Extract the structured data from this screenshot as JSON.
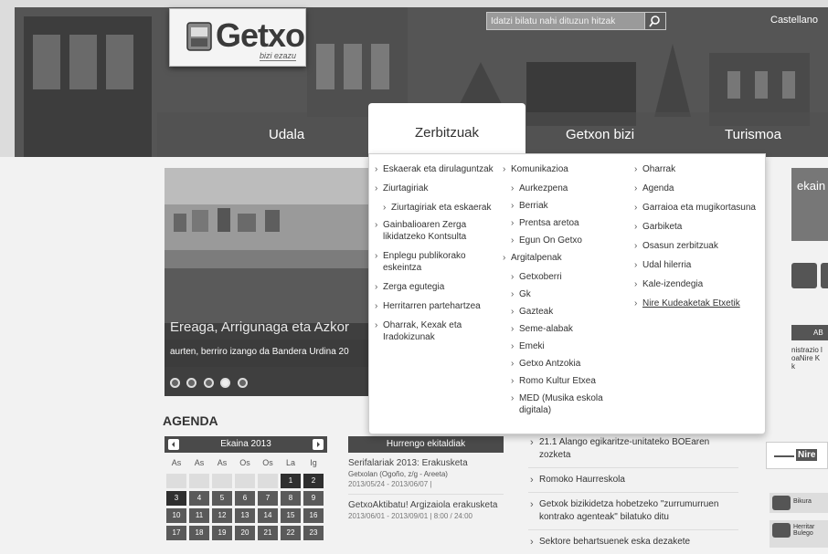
{
  "header": {
    "logo_text": "Getxo",
    "logo_tagline": "bizi ezazu",
    "search_placeholder": "Idatzi bilatu nahi dituzun hitzak",
    "language": "Castellano"
  },
  "nav": {
    "items": [
      "Udala",
      "Zerbitzuak",
      "Getxon bizi",
      "Turismoa"
    ],
    "active": "Zerbitzuak"
  },
  "dropdown": {
    "col1": [
      "Eskaerak eta dirulaguntzak",
      "Ziurtagiriak",
      "Ziurtagiriak eta eskaerak",
      "Gainbalioaren Zerga likidatzeko Kontsulta",
      "Enplegu publikorako eskeintza",
      "Zerga egutegia",
      "Herritarren partehartzea",
      "Oharrak, Kexak eta Iradokizunak"
    ],
    "col2": [
      "Komunikazioa",
      "Aurkezpena",
      "Berriak",
      "Prentsa aretoa",
      "Egun On Getxo",
      "Argitalpenak",
      "Getxoberri",
      "Gk",
      "Gazteak",
      "Seme-alabak",
      "Emeki",
      "Getxo Antzokia",
      "Romo Kultur Etxea",
      "MED (Musika eskola digitala)"
    ],
    "col3": [
      "Oharrak",
      "Agenda",
      "Garraioa eta mugikortasuna",
      "Garbiketa",
      "Osasun zerbitzuak",
      "Udal hilerria",
      "Kale-izendegia",
      "Nire Kudeaketak Etxetik"
    ]
  },
  "slider": {
    "title": "Ereaga, Arrigunaga eta Azkor",
    "subtitle": "aurten, berriro izango da Bandera Urdina 20"
  },
  "agenda": {
    "title": "AGENDA",
    "month": "Ekaina 2013",
    "weekdays": [
      "As",
      "As",
      "As",
      "Os",
      "Os",
      "La",
      "Ig"
    ],
    "days": [
      "",
      "",
      "",
      "",
      "",
      "1",
      "2",
      "3",
      "4",
      "5",
      "6",
      "7",
      "8",
      "9",
      "10",
      "11",
      "12",
      "13",
      "14",
      "15",
      "16",
      "17",
      "18",
      "19",
      "20",
      "21",
      "22",
      "23"
    ]
  },
  "events": {
    "header": "Hurrengo ekitaldiak",
    "items": [
      {
        "title": "Serifalariak 2013: Erakusketa",
        "place": "Getxolan (Ogoño, z/g - Areeta)",
        "date": "2013/05/24 - 2013/06/07 |"
      },
      {
        "title": "GetxoAktibatu! Argizaiola erakusketa",
        "date": "2013/06/01 - 2013/09/01 | 8:00 / 24:00"
      }
    ]
  },
  "news": [
    "21.1 Alango egikaritze-unitateko BOEaren zozketa",
    "Romoko Haurreskola",
    "Getxok bizikidetza hobetzeko \"zurrumurruen kontrako agenteak\" bilatuko ditu",
    "Sektore behartsuenek eska dezakete"
  ],
  "right": {
    "ekain": "ekain",
    "ab_label": "AB",
    "ab_text_1": "nistrazio l",
    "ab_text_2": "oaNire K",
    "ab_text_3": "k",
    "nire_label": "Nire",
    "bikura": "Bikura",
    "herritar": "Herritar Bulego"
  }
}
